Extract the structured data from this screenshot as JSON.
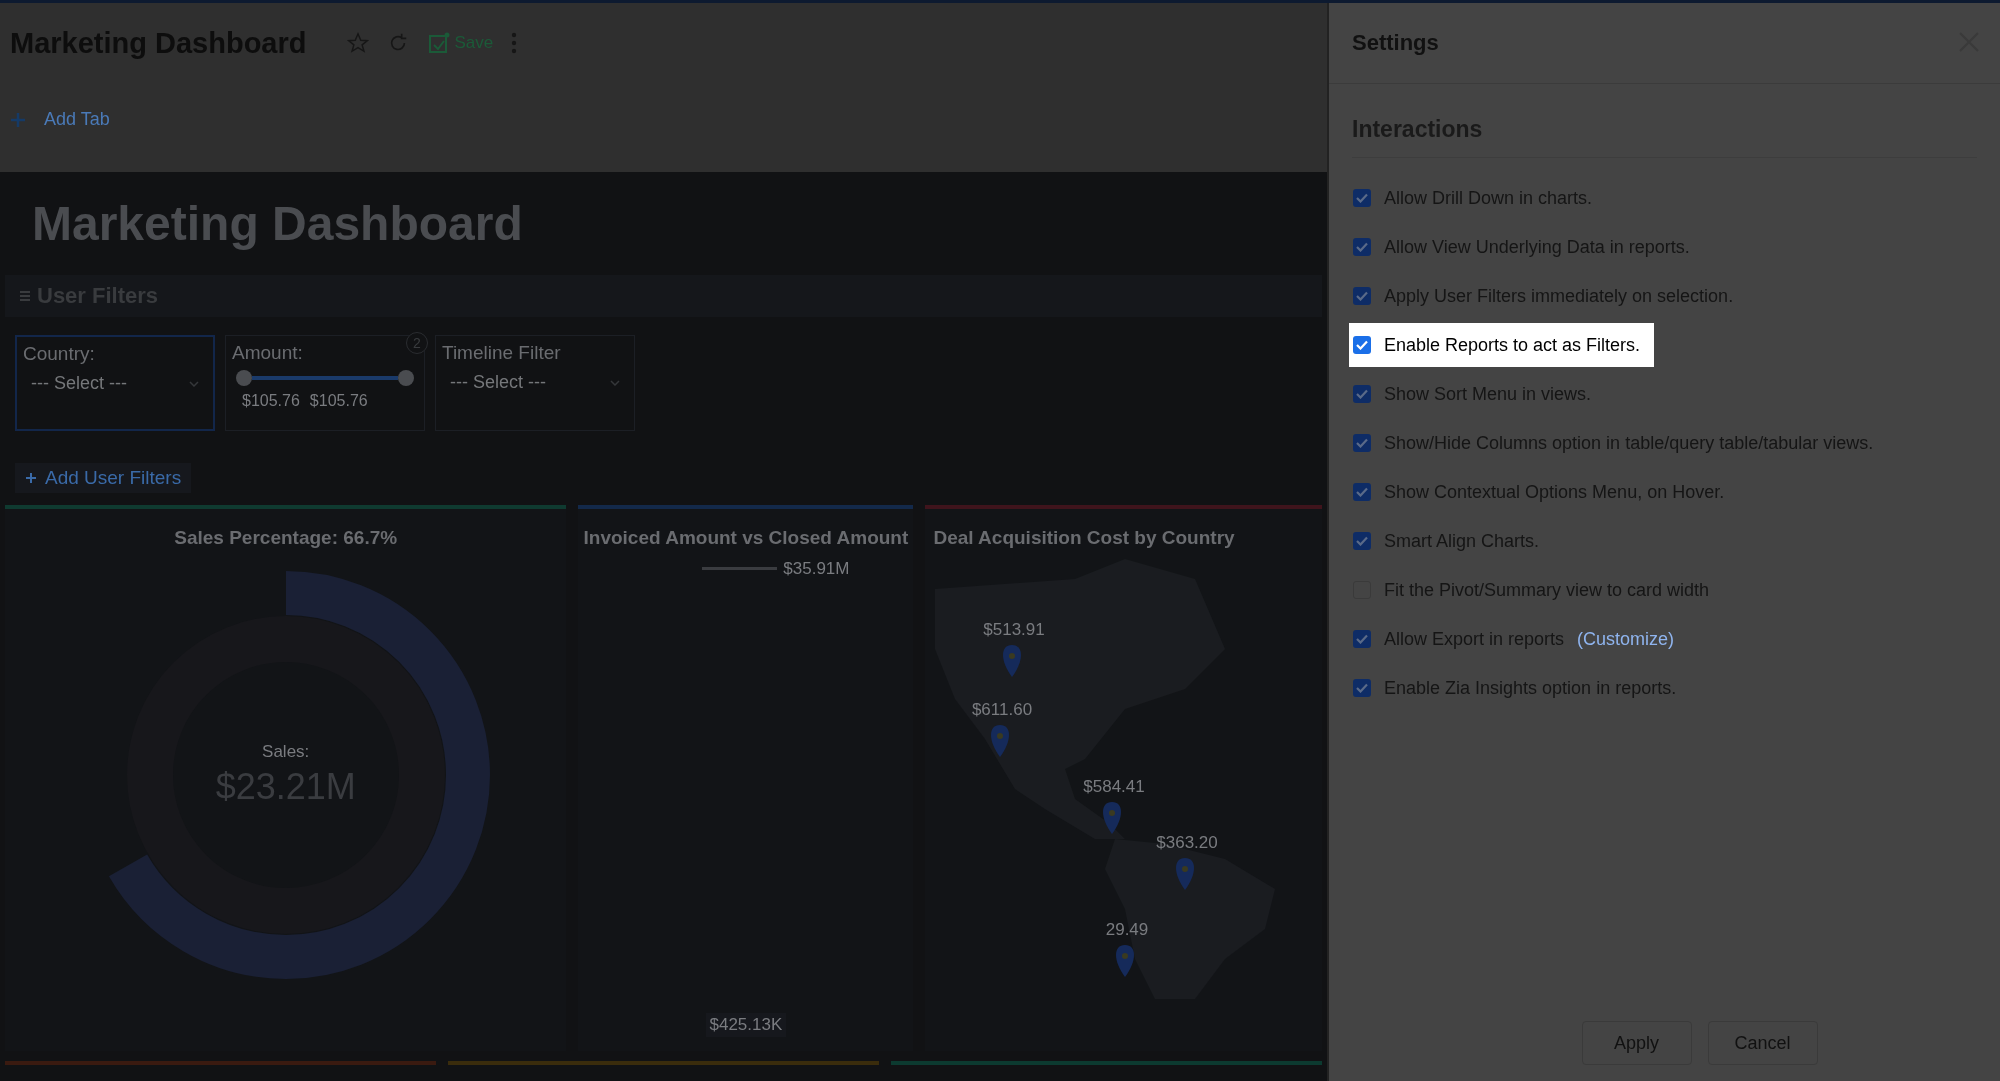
{
  "app_bar": {
    "title": "Marketing Dashboard",
    "save_label": "Save",
    "add_tab": "Add Tab"
  },
  "dashboard": {
    "title": "Marketing Dashboard",
    "filters_title": "User Filters",
    "filters": [
      {
        "kind": "select",
        "label": "Country:",
        "placeholder": "--- Select ---",
        "focused": true
      },
      {
        "kind": "range",
        "label": "Amount:",
        "badge": "2",
        "level": 1,
        "min": "$105.76",
        "max": "$105.76"
      },
      {
        "kind": "select",
        "label": "Timeline Filter",
        "placeholder": "--- Select ---",
        "focused": false
      }
    ],
    "add_filters": "Add User Filters",
    "cards": [
      {
        "kind": "donut",
        "title": "Sales Percentage: 66.7%",
        "color": "#0f3a30",
        "center_label": "Sales:",
        "center_value": "$23.21M",
        "level": 0.667
      },
      {
        "kind": "line",
        "title": "Invoiced Amount vs Closed Amount",
        "color": "#13294a",
        "top_value": "$35.91M",
        "bottom_value": "$425.13K"
      },
      {
        "kind": "map",
        "title": "Deal Acquisition Cost by Country",
        "color": "#3f141c",
        "pins": [
          {
            "label": "$513.91"
          },
          {
            "label": "$611.60"
          },
          {
            "label": "$584.41"
          },
          {
            "label": "$363.20"
          },
          {
            "label": "29.49"
          }
        ]
      }
    ]
  },
  "settings": {
    "title": "Settings",
    "section": "Interactions",
    "options": [
      {
        "label": "Allow Drill Down in charts.",
        "checked": true,
        "highlighted": false
      },
      {
        "label": "Allow View Underlying Data in reports.",
        "checked": true,
        "highlighted": false
      },
      {
        "label": "Apply User Filters immediately on selection.",
        "checked": true,
        "highlighted": false
      },
      {
        "label": "Enable Reports to act as Filters.",
        "checked": true,
        "highlighted": true
      },
      {
        "label": "Show Sort Menu in views.",
        "checked": true,
        "highlighted": false
      },
      {
        "label": "Show/Hide Columns option in table/query table/tabular views.",
        "checked": true,
        "highlighted": false
      },
      {
        "label": "Show Contextual Options Menu, on Hover.",
        "checked": true,
        "highlighted": false
      },
      {
        "label": "Smart Align Charts.",
        "checked": true,
        "highlighted": false
      },
      {
        "label": "Fit the Pivot/Summary view to card width",
        "checked": false,
        "highlighted": false
      },
      {
        "label": "Allow Export in reports",
        "link": "(Customize)",
        "checked": true,
        "highlighted": false
      },
      {
        "label": "Enable Zia Insights option in reports.",
        "checked": true,
        "highlighted": false
      }
    ],
    "buttons": [
      "Apply",
      "Cancel"
    ]
  }
}
